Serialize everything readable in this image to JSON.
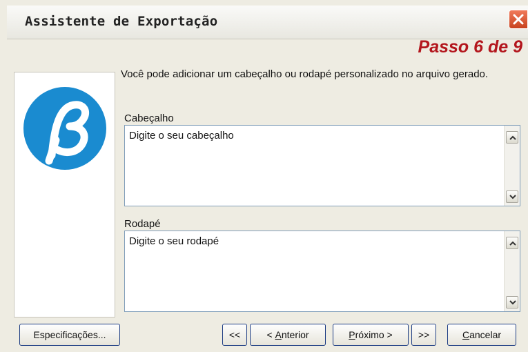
{
  "window": {
    "title": "Assistente de Exportação"
  },
  "step": {
    "label": "Passo 6 de 9"
  },
  "description": "Você pode adicionar um cabeçalho ou rodapé personalizado no arquivo gerado.",
  "header": {
    "label": "Cabeçalho",
    "value": "Digite o seu cabeçalho"
  },
  "footer": {
    "label": "Rodapé",
    "value": "Digite o seu rodapé"
  },
  "buttons": {
    "specifications": "Especificações...",
    "first": "<<",
    "previous_prefix": "< ",
    "previous_mnemonic": "A",
    "previous_rest": "nterior",
    "next_mnemonic": "P",
    "next_rest": "róximo >",
    "last": ">>",
    "cancel_mnemonic": "C",
    "cancel_rest": "ancelar"
  },
  "colors": {
    "step": "#b3161d",
    "logo": "#1a8bd0",
    "title_close": "#d9542f"
  }
}
